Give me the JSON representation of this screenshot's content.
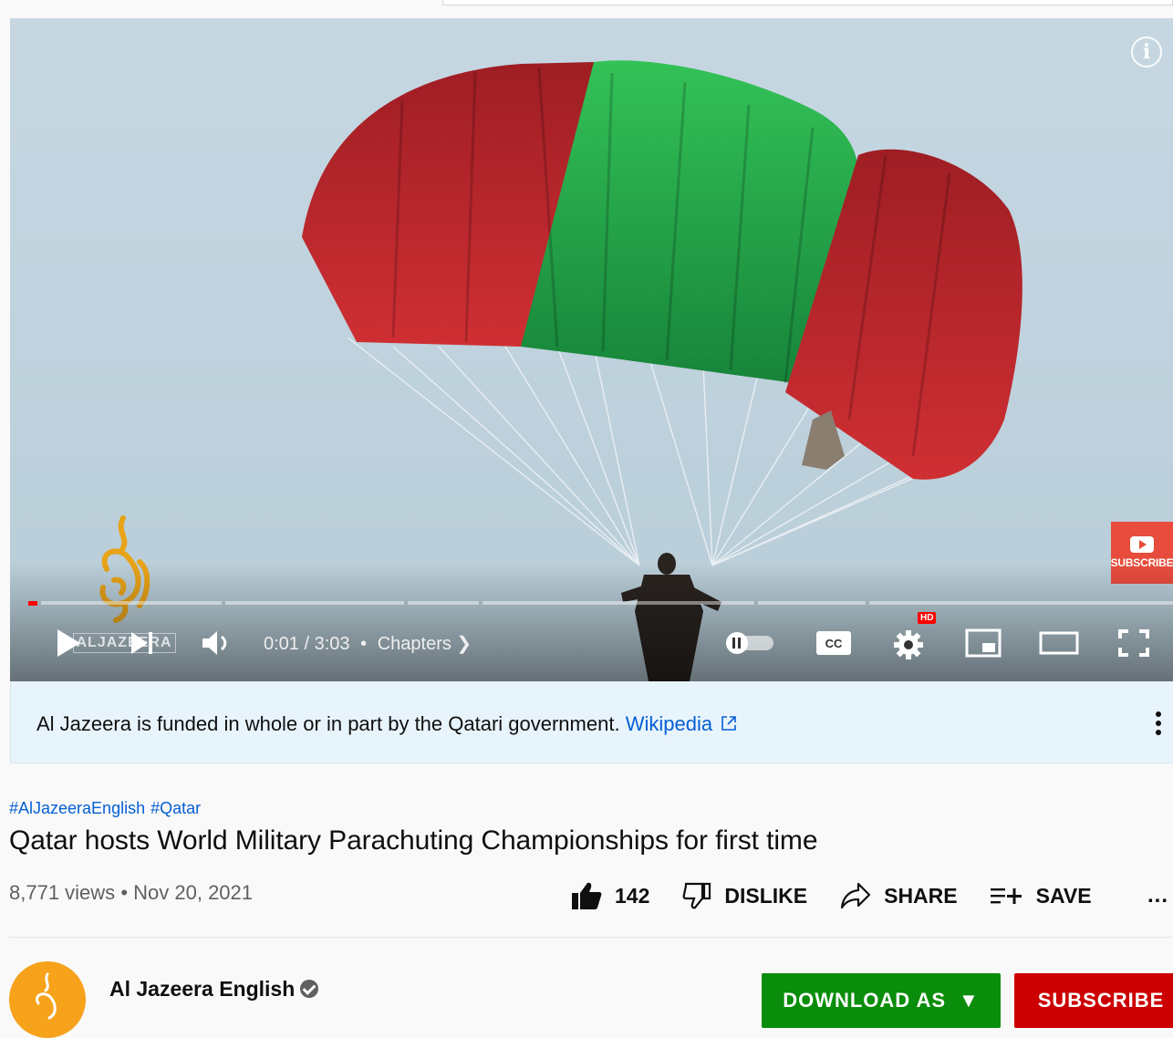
{
  "player": {
    "time_current": "0:01",
    "time_separator": "/",
    "time_total": "3:03",
    "chapters_label": "Chapters",
    "progress_fraction": 0.003,
    "watermark_subscribe": "SUBSCRIBE",
    "overlay_logo_text": "ALJAZEERA",
    "hd_badge": "HD"
  },
  "notice": {
    "text": "Al Jazeera is funded in whole or in part by the Qatari government.",
    "link_label": "Wikipedia"
  },
  "video": {
    "hashtags": [
      "#AlJazeeraEnglish",
      "#Qatar"
    ],
    "title": "Qatar hosts World Military Parachuting Championships for first time",
    "views": "8,771 views",
    "date": "Nov 20, 2021",
    "like_count": "142",
    "dislike_label": "DISLIKE",
    "share_label": "SHARE",
    "save_label": "SAVE",
    "more_label": "..."
  },
  "channel": {
    "name": "Al Jazeera English",
    "download_label": "DOWNLOAD AS",
    "subscribe_label": "SUBSCRIBE"
  },
  "colors": {
    "link": "#065fd4",
    "notice_bg": "#e8f4fc",
    "progress": "#ff0000",
    "download_button": "#0a8d0a",
    "subscribe_button": "#cc0000",
    "canopy_red": "#c0272d",
    "canopy_green": "#1f9a3c"
  }
}
